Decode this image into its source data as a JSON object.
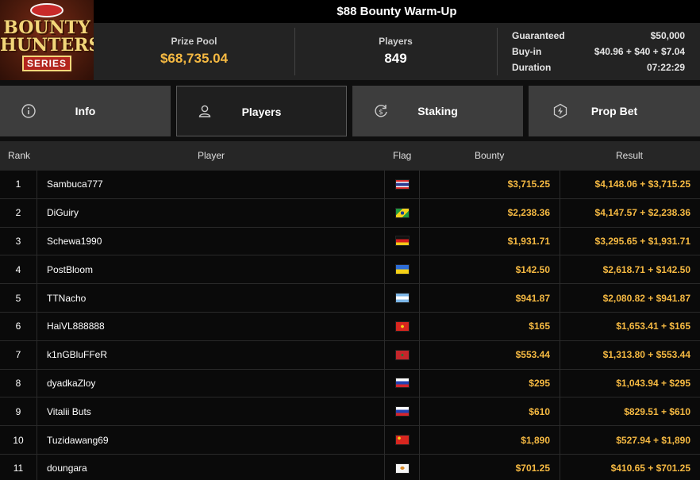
{
  "logo": {
    "line1": "BOUNTY",
    "line2": "HUNTERS",
    "line3": "SERIES"
  },
  "title": "$88 Bounty Warm-Up",
  "stats": {
    "prize_pool_label": "Prize Pool",
    "prize_pool_value": "$68,735.04",
    "players_label": "Players",
    "players_value": "849",
    "guaranteed_label": "Guaranteed",
    "guaranteed_value": "$50,000",
    "buyin_label": "Buy-in",
    "buyin_value": "$40.96 + $40 + $7.04",
    "duration_label": "Duration",
    "duration_value": "07:22:29"
  },
  "tabs": [
    {
      "label": "Info",
      "icon": "info-icon"
    },
    {
      "label": "Players",
      "icon": "user-icon"
    },
    {
      "label": "Staking",
      "icon": "dollar-cycle-icon"
    },
    {
      "label": "Prop Bet",
      "icon": "lightning-icon"
    }
  ],
  "columns": {
    "rank": "Rank",
    "player": "Player",
    "flag": "Flag",
    "bounty": "Bounty",
    "result": "Result"
  },
  "rows": [
    {
      "rank": "1",
      "player": "Sambuca777",
      "flag": "thailand",
      "bounty": "$3,715.25",
      "result": "$4,148.06 + $3,715.25"
    },
    {
      "rank": "2",
      "player": "DiGuiry",
      "flag": "brazil",
      "bounty": "$2,238.36",
      "result": "$4,147.57 + $2,238.36"
    },
    {
      "rank": "3",
      "player": "Schewa1990",
      "flag": "germany",
      "bounty": "$1,931.71",
      "result": "$3,295.65 + $1,931.71"
    },
    {
      "rank": "4",
      "player": "PostBloom",
      "flag": "ukraine",
      "bounty": "$142.50",
      "result": "$2,618.71 + $142.50"
    },
    {
      "rank": "5",
      "player": "TTNacho",
      "flag": "argentina",
      "bounty": "$941.87",
      "result": "$2,080.82 + $941.87"
    },
    {
      "rank": "6",
      "player": "HaiVL888888",
      "flag": "vietnam",
      "bounty": "$165",
      "result": "$1,653.41 + $165"
    },
    {
      "rank": "7",
      "player": "k1nGBluFFeR",
      "flag": "morocco",
      "bounty": "$553.44",
      "result": "$1,313.80 + $553.44"
    },
    {
      "rank": "8",
      "player": "dyadkaZloy",
      "flag": "russia",
      "bounty": "$295",
      "result": "$1,043.94 + $295"
    },
    {
      "rank": "9",
      "player": "Vitalii Buts",
      "flag": "russia",
      "bounty": "$610",
      "result": "$829.51 + $610"
    },
    {
      "rank": "10",
      "player": "Tuzidawang69",
      "flag": "china",
      "bounty": "$1,890",
      "result": "$527.94 + $1,890"
    },
    {
      "rank": "11",
      "player": "doungara",
      "flag": "cyprus",
      "bounty": "$701.25",
      "result": "$410.65 + $701.25"
    }
  ]
}
